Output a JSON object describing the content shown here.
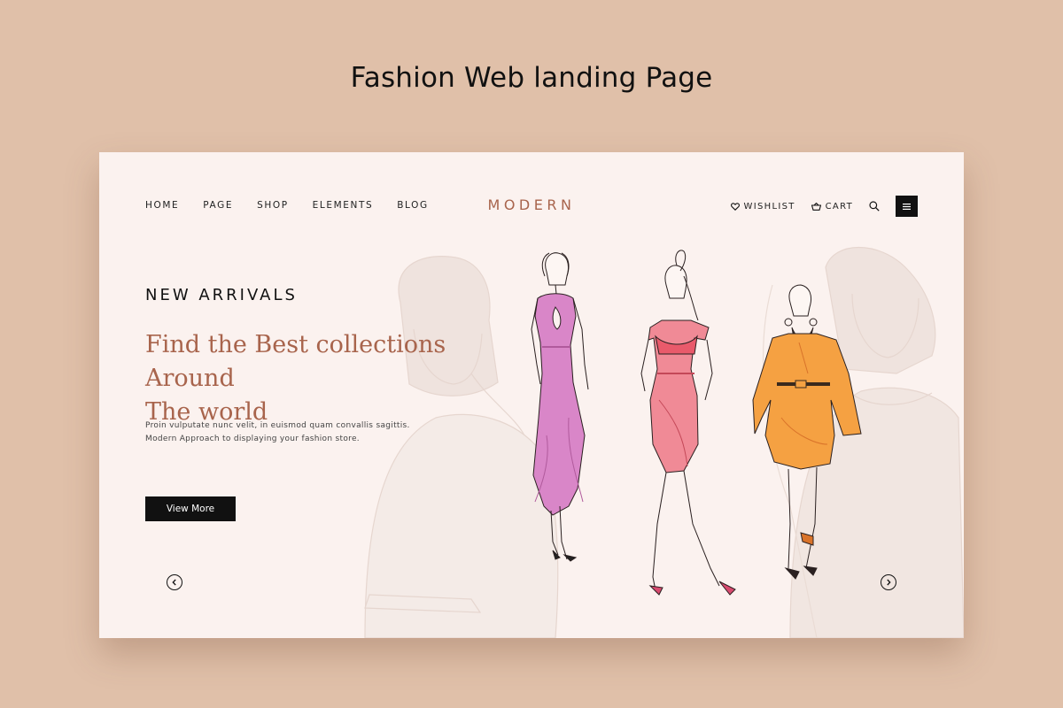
{
  "page_heading": "Fashion Web landing Page",
  "nav": {
    "links": [
      "HOME",
      "PAGE",
      "SHOP",
      "ELEMENTS",
      "BLOG"
    ],
    "brand": "MODERN",
    "wishlist_label": "WISHLIST",
    "cart_label": "CART",
    "icons": {
      "wishlist": "heart-icon",
      "cart": "basket-icon",
      "search": "search-icon",
      "menu": "hamburger-menu-icon"
    }
  },
  "hero": {
    "eyebrow": "NEW ARRIVALS",
    "title_line1": "Find the Best collections Around",
    "title_line2": "The world",
    "desc_line1": "Proin vulputate nunc velit, in euismod quam convallis sagittis.",
    "desc_line2": "Modern Approach to displaying your fashion store.",
    "cta_label": "View More"
  },
  "carousel": {
    "prev_icon": "chevron-left-icon",
    "next_icon": "chevron-right-icon"
  },
  "colors": {
    "background": "#e0c0a9",
    "card": "#fbf2ef",
    "accent": "#a8644c",
    "button": "#111111",
    "dress_pink": "#d77fc0",
    "dress_coral": "#f28b94",
    "dress_orange": "#f5a142"
  }
}
